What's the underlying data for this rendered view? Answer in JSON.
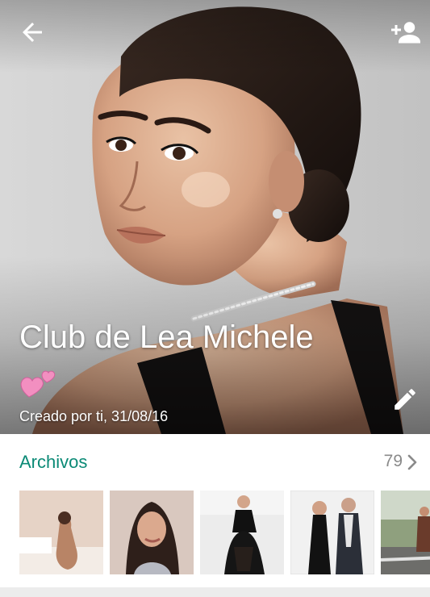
{
  "header": {
    "title": "Club de Lea Michele",
    "subtitle": "Creado por ti, 31/08/16",
    "back_icon": "arrow-back-icon",
    "add_icon": "add-participant-icon",
    "edit_icon": "pencil-icon",
    "emoji": "two-hearts"
  },
  "media": {
    "title": "Archivos",
    "count": "79",
    "chevron_icon": "chevron-right-icon",
    "accent_color": "#0b8a76",
    "thumbnails": [
      {
        "name": "media-thumb-1"
      },
      {
        "name": "media-thumb-2"
      },
      {
        "name": "media-thumb-3"
      },
      {
        "name": "media-thumb-4"
      },
      {
        "name": "media-thumb-5"
      }
    ]
  }
}
